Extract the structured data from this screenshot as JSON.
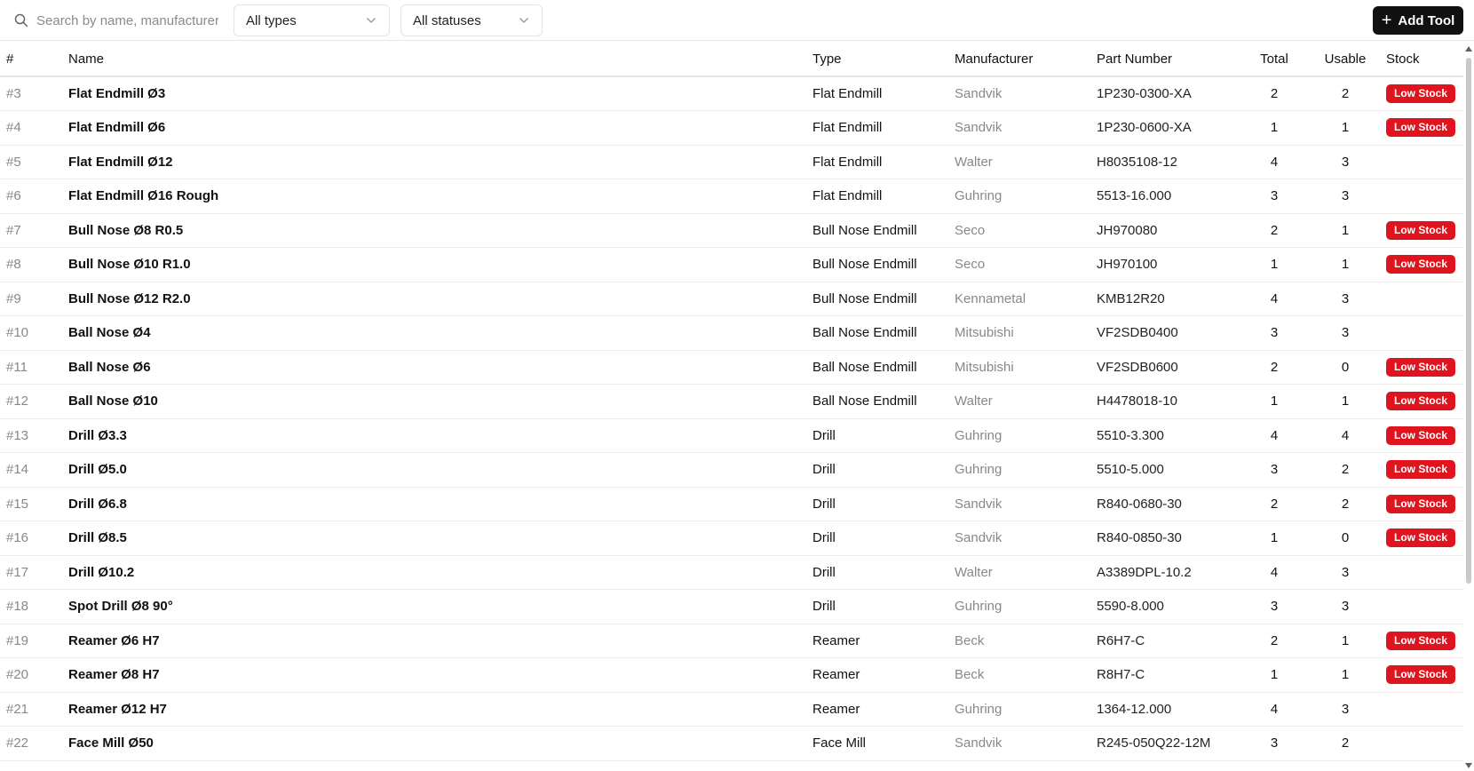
{
  "toolbar": {
    "search_placeholder": "Search by name, manufacturer",
    "type_filter": "All types",
    "status_filter": "All statuses",
    "add_button": "Add Tool"
  },
  "table": {
    "headers": {
      "id": "#",
      "name": "Name",
      "type": "Type",
      "manufacturer": "Manufacturer",
      "part_number": "Part Number",
      "total": "Total",
      "usable": "Usable",
      "stock": "Stock"
    },
    "low_stock_label": "Low Stock",
    "rows": [
      {
        "id": "#3",
        "name": "Flat Endmill Ø3",
        "type": "Flat Endmill",
        "manufacturer": "Sandvik",
        "part_number": "1P230-0300-XA",
        "total": "2",
        "usable": "2",
        "stock": "Low Stock"
      },
      {
        "id": "#4",
        "name": "Flat Endmill Ø6",
        "type": "Flat Endmill",
        "manufacturer": "Sandvik",
        "part_number": "1P230-0600-XA",
        "total": "1",
        "usable": "1",
        "stock": "Low Stock"
      },
      {
        "id": "#5",
        "name": "Flat Endmill Ø12",
        "type": "Flat Endmill",
        "manufacturer": "Walter",
        "part_number": "H8035108-12",
        "total": "4",
        "usable": "3",
        "stock": ""
      },
      {
        "id": "#6",
        "name": "Flat Endmill Ø16 Rough",
        "type": "Flat Endmill",
        "manufacturer": "Guhring",
        "part_number": "5513-16.000",
        "total": "3",
        "usable": "3",
        "stock": ""
      },
      {
        "id": "#7",
        "name": "Bull Nose Ø8 R0.5",
        "type": "Bull Nose Endmill",
        "manufacturer": "Seco",
        "part_number": "JH970080",
        "total": "2",
        "usable": "1",
        "stock": "Low Stock"
      },
      {
        "id": "#8",
        "name": "Bull Nose Ø10 R1.0",
        "type": "Bull Nose Endmill",
        "manufacturer": "Seco",
        "part_number": "JH970100",
        "total": "1",
        "usable": "1",
        "stock": "Low Stock"
      },
      {
        "id": "#9",
        "name": "Bull Nose Ø12 R2.0",
        "type": "Bull Nose Endmill",
        "manufacturer": "Kennametal",
        "part_number": "KMB12R20",
        "total": "4",
        "usable": "3",
        "stock": ""
      },
      {
        "id": "#10",
        "name": "Ball Nose Ø4",
        "type": "Ball Nose Endmill",
        "manufacturer": "Mitsubishi",
        "part_number": "VF2SDB0400",
        "total": "3",
        "usable": "3",
        "stock": ""
      },
      {
        "id": "#11",
        "name": "Ball Nose Ø6",
        "type": "Ball Nose Endmill",
        "manufacturer": "Mitsubishi",
        "part_number": "VF2SDB0600",
        "total": "2",
        "usable": "0",
        "stock": "Low Stock"
      },
      {
        "id": "#12",
        "name": "Ball Nose Ø10",
        "type": "Ball Nose Endmill",
        "manufacturer": "Walter",
        "part_number": "H4478018-10",
        "total": "1",
        "usable": "1",
        "stock": "Low Stock"
      },
      {
        "id": "#13",
        "name": "Drill Ø3.3",
        "type": "Drill",
        "manufacturer": "Guhring",
        "part_number": "5510-3.300",
        "total": "4",
        "usable": "4",
        "stock": "Low Stock"
      },
      {
        "id": "#14",
        "name": "Drill Ø5.0",
        "type": "Drill",
        "manufacturer": "Guhring",
        "part_number": "5510-5.000",
        "total": "3",
        "usable": "2",
        "stock": "Low Stock"
      },
      {
        "id": "#15",
        "name": "Drill Ø6.8",
        "type": "Drill",
        "manufacturer": "Sandvik",
        "part_number": "R840-0680-30",
        "total": "2",
        "usable": "2",
        "stock": "Low Stock"
      },
      {
        "id": "#16",
        "name": "Drill Ø8.5",
        "type": "Drill",
        "manufacturer": "Sandvik",
        "part_number": "R840-0850-30",
        "total": "1",
        "usable": "0",
        "stock": "Low Stock"
      },
      {
        "id": "#17",
        "name": "Drill Ø10.2",
        "type": "Drill",
        "manufacturer": "Walter",
        "part_number": "A3389DPL-10.2",
        "total": "4",
        "usable": "3",
        "stock": ""
      },
      {
        "id": "#18",
        "name": "Spot Drill Ø8 90°",
        "type": "Drill",
        "manufacturer": "Guhring",
        "part_number": "5590-8.000",
        "total": "3",
        "usable": "3",
        "stock": ""
      },
      {
        "id": "#19",
        "name": "Reamer Ø6 H7",
        "type": "Reamer",
        "manufacturer": "Beck",
        "part_number": "R6H7-C",
        "total": "2",
        "usable": "1",
        "stock": "Low Stock"
      },
      {
        "id": "#20",
        "name": "Reamer Ø8 H7",
        "type": "Reamer",
        "manufacturer": "Beck",
        "part_number": "R8H7-C",
        "total": "1",
        "usable": "1",
        "stock": "Low Stock"
      },
      {
        "id": "#21",
        "name": "Reamer Ø12 H7",
        "type": "Reamer",
        "manufacturer": "Guhring",
        "part_number": "1364-12.000",
        "total": "4",
        "usable": "3",
        "stock": ""
      },
      {
        "id": "#22",
        "name": "Face Mill Ø50",
        "type": "Face Mill",
        "manufacturer": "Sandvik",
        "part_number": "R245-050Q22-12M",
        "total": "3",
        "usable": "2",
        "stock": ""
      }
    ]
  },
  "colors": {
    "accent": "#111111",
    "low_stock": "#e0141e",
    "muted_text": "#888888"
  },
  "icons": {
    "search": "search-icon",
    "chevron": "chevron-down-icon",
    "add": "plus-icon"
  }
}
